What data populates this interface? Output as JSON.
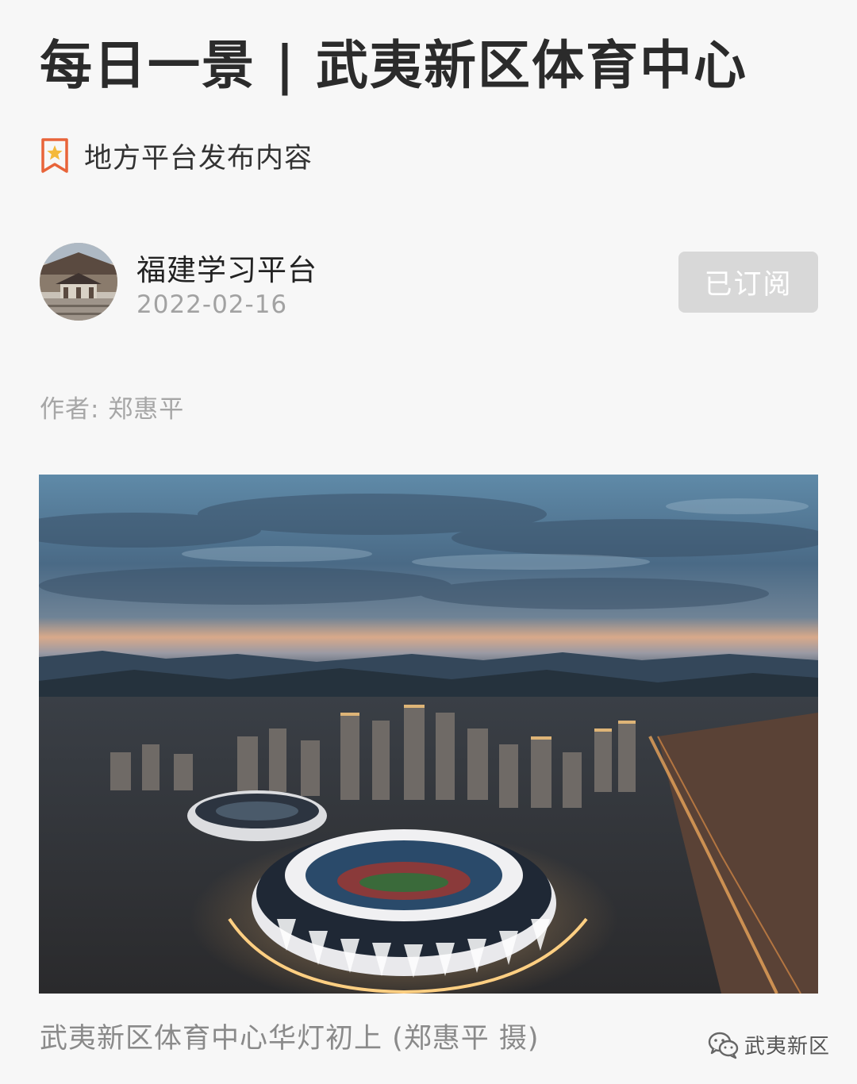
{
  "article": {
    "title": "每日一景 | 武夷新区体育中心",
    "source_tag": "地方平台发布内容",
    "author": "作者: 郑惠平",
    "image_caption": "武夷新区体育中心华灯初上 (郑惠平  摄)"
  },
  "publisher": {
    "name": "福建学习平台",
    "date": "2022-02-16",
    "subscribe_label": "已订阅"
  },
  "watermark": {
    "text": "武夷新区"
  },
  "icons": {
    "source_tag": "bookmark-star-icon",
    "watermark": "wechat-icon"
  },
  "colors": {
    "bookmark": "#e8643a",
    "star": "#f4b93a",
    "button_bg": "#d8d8d8",
    "muted_text": "#a6a6a6"
  }
}
